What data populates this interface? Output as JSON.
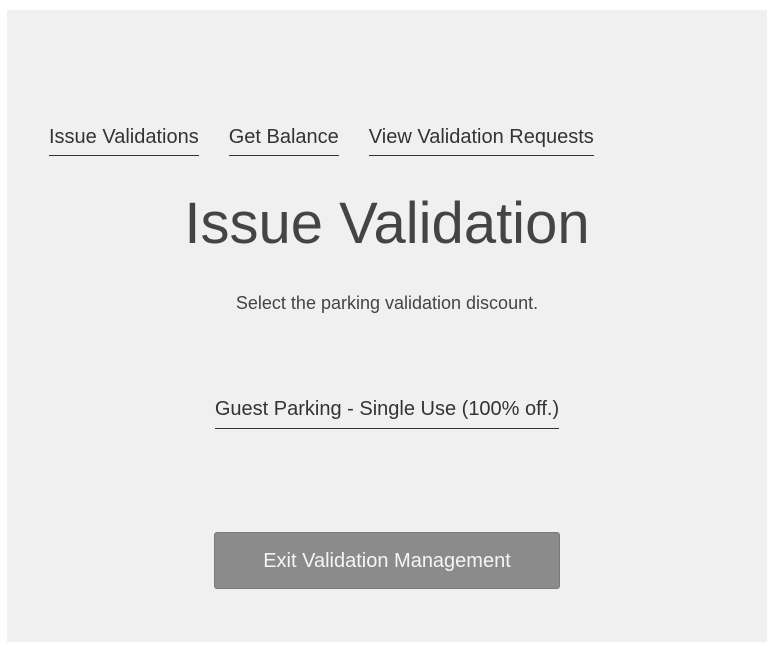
{
  "nav": {
    "items": [
      {
        "label": "Issue Validations"
      },
      {
        "label": "Get Balance"
      },
      {
        "label": "View Validation Requests"
      }
    ]
  },
  "main": {
    "title": "Issue Validation",
    "subtitle": "Select the parking validation discount.",
    "discount_option": "Guest Parking - Single Use (100% off.)"
  },
  "footer": {
    "exit_label": "Exit Validation Management"
  },
  "colors": {
    "panel_background": "#f0f0f0",
    "text": "#333333",
    "button_background": "#8b8b8b",
    "button_text": "#f5f5f5"
  }
}
